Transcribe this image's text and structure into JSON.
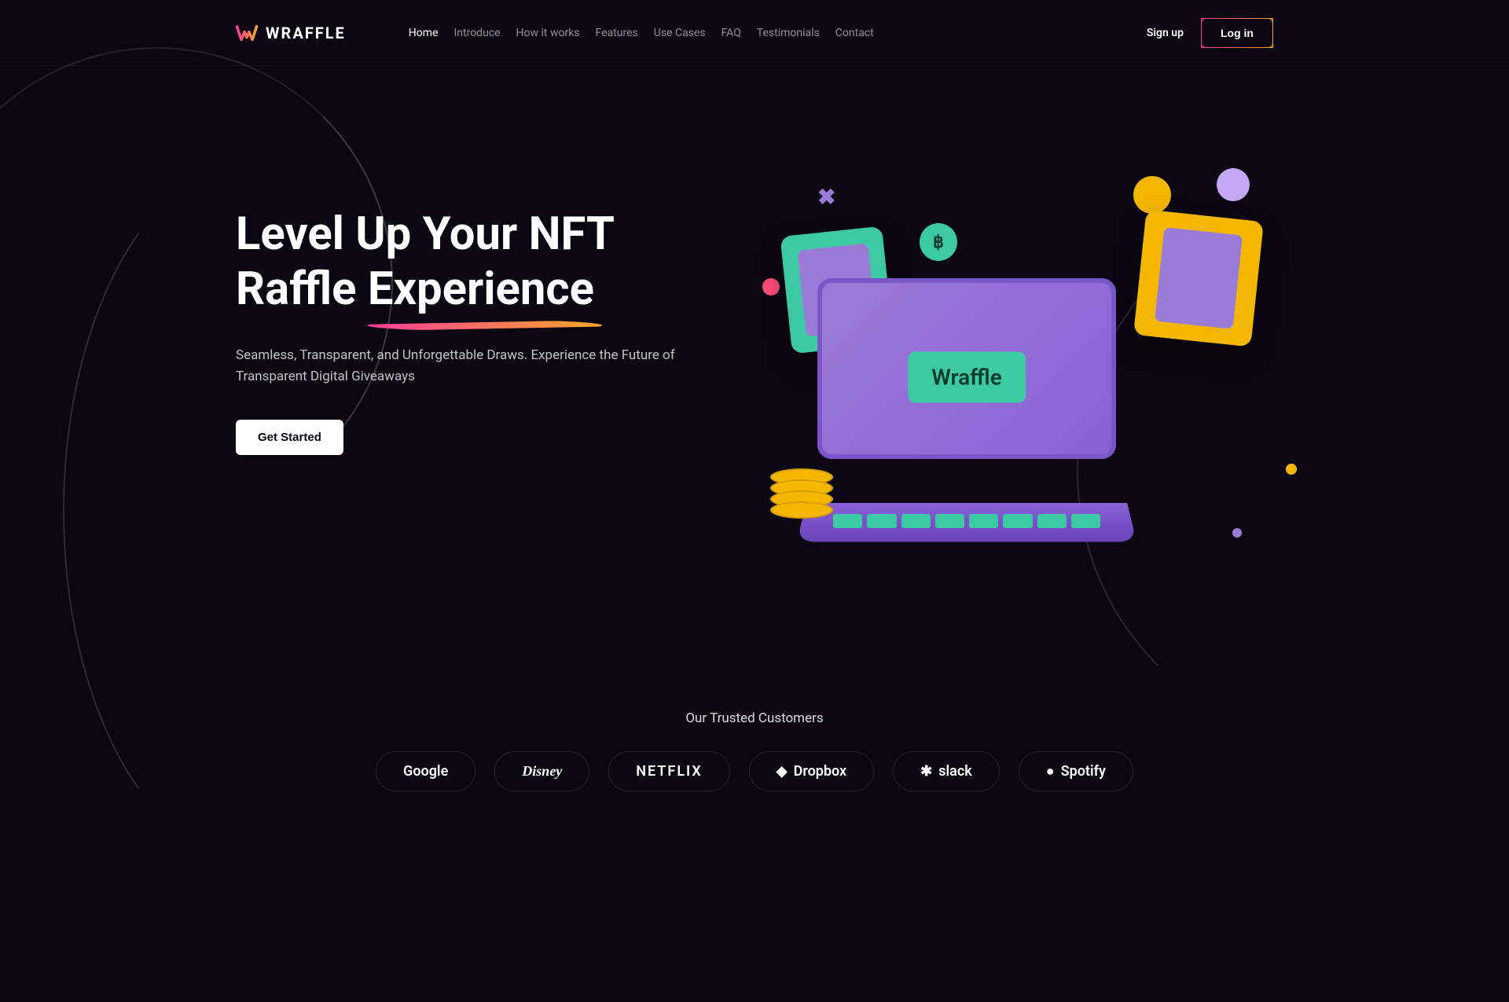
{
  "brand": "WRAFFLE",
  "nav": {
    "items": [
      "Home",
      "Introduce",
      "How it works",
      "Features",
      "Use Cases",
      "FAQ",
      "Testimonials",
      "Contact"
    ],
    "active_index": 0
  },
  "auth": {
    "signup": "Sign up",
    "login": "Log in"
  },
  "hero": {
    "title_line1": "Level Up Your NFT",
    "title_line2_word1": "Raffle",
    "title_line2_word2": "Experience",
    "subtitle": "Seamless, Transparent, and Unforgettable Draws. Experience the Future of Transparent Digital Giveaways",
    "cta": "Get Started",
    "illustration_label": "Wraffle"
  },
  "customers": {
    "title": "Our Trusted Customers",
    "list": [
      "Google",
      "Disney",
      "NETFLIX",
      "Dropbox",
      "slack",
      "Spotify"
    ]
  }
}
